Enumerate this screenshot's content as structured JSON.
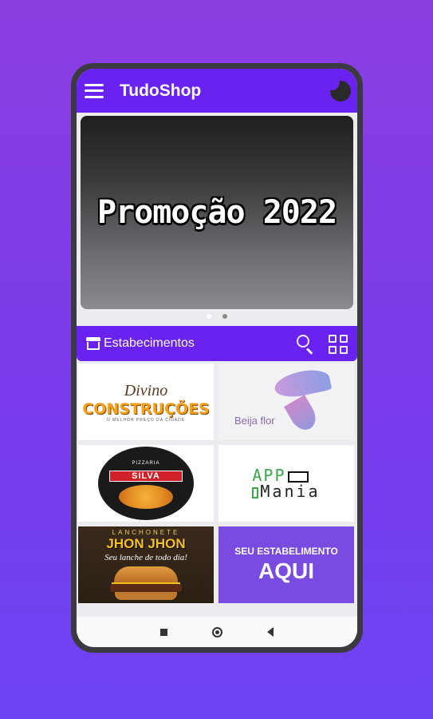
{
  "app": {
    "title": "TudoShop",
    "icons": {
      "menu": "hamburger-menu-icon",
      "theme": "dark-mode-toggle-icon"
    },
    "accent_color": "#6a22f0"
  },
  "banner": {
    "text": "Promoção 2022",
    "pages": 2,
    "active_page": 1
  },
  "section": {
    "title": "Estabecimentos",
    "icons": {
      "leading": "store-icon",
      "search": "search-icon",
      "view": "grid-view-icon"
    }
  },
  "establishments": [
    {
      "name": "Divino Construções",
      "logo_title": "Divino",
      "logo_main": "CONSTRUÇÕES",
      "logo_tagline": "O MELHOR PREÇO DA CIDADE"
    },
    {
      "name": "Beija flor",
      "logo_title": "Beija flor"
    },
    {
      "name": "Pizzaria Silva",
      "logo_top": "PIZZARIA",
      "logo_main": "SILVA"
    },
    {
      "name": "App Mania",
      "logo_line1": "APP",
      "logo_line2": "Mania"
    },
    {
      "name": "Lanchonete Jhon Jhon",
      "logo_top": "LANCHONETE",
      "logo_main": "JHON JHON",
      "logo_tagline": "Seu lanche de todo dia!"
    },
    {
      "name": "Seu Estabelimento Aqui",
      "logo_small": "SEU ESTABELIMENTO",
      "logo_big": "AQUI"
    }
  ],
  "navbar": {
    "icons": {
      "recent": "recent-apps-icon",
      "home": "home-icon",
      "back": "back-icon"
    }
  }
}
